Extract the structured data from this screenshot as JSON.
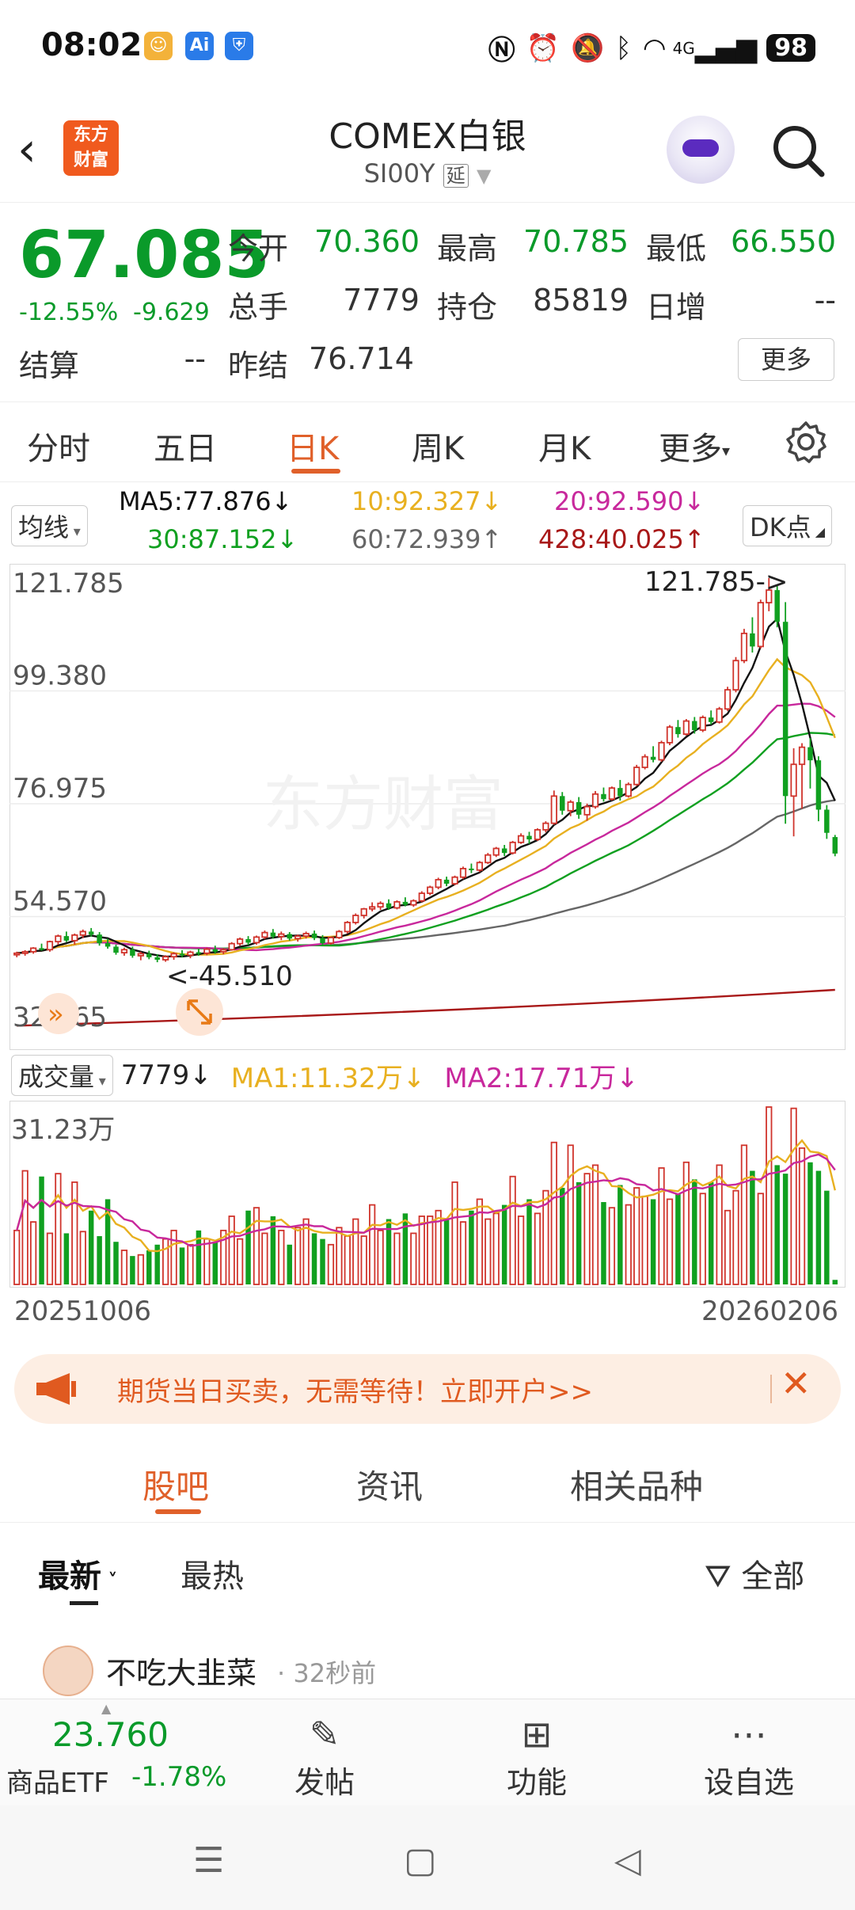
{
  "status": {
    "time": "08:02",
    "battery": "98",
    "net": "4G"
  },
  "header": {
    "back": "‹",
    "logo_line1": "东方",
    "logo_line2": "财富",
    "title": "COMEX白银",
    "code": "SI00Y",
    "delay_tag": "延"
  },
  "quote": {
    "price": "67.085",
    "pct": "-12.55%",
    "chg": "-9.629",
    "open_label": "今开",
    "open": "70.360",
    "high_label": "最高",
    "high": "70.785",
    "low_label": "最低",
    "low": "66.550",
    "vol_label": "总手",
    "vol": "7779",
    "oi_label": "持仓",
    "oi": "85819",
    "inc_label": "日增",
    "inc": "--",
    "settle_label": "结算",
    "settle": "--",
    "prev_label": "昨结",
    "prev": "76.714",
    "more": "更多"
  },
  "period_tabs": [
    "分时",
    "五日",
    "日K",
    "周K",
    "月K",
    "更多"
  ],
  "ma": {
    "selector": "均线",
    "dk": "DK点",
    "ma5": "MA5:77.876↓",
    "ma10": "10:92.327↓",
    "ma20": "20:92.590↓",
    "ma30": "30:87.152↓",
    "ma60": "60:72.939↑",
    "ma428": "428:40.025↑",
    "colors": {
      "ma5": "#111111",
      "ma10": "#e8b020",
      "ma20": "#c8289c",
      "ma30": "#10a020",
      "ma60": "#666666",
      "ma428": "#a81818"
    }
  },
  "chart_data": {
    "type": "candlestick",
    "y_ticks": [
      "121.785",
      "99.380",
      "76.975",
      "54.570",
      "32.165"
    ],
    "ylim": [
      32.165,
      121.785
    ],
    "high_marker": "121.785->",
    "low_marker": "<-45.510",
    "watermark": "东方财富",
    "start_date": "20251006",
    "end_date": "20260206",
    "candles": [
      [
        47.0,
        47.6,
        46.5,
        47.3
      ],
      [
        47.3,
        47.9,
        46.8,
        47.6
      ],
      [
        47.6,
        48.5,
        47.2,
        48.3
      ],
      [
        48.3,
        49.2,
        47.8,
        48.0
      ],
      [
        48.0,
        49.8,
        47.6,
        49.6
      ],
      [
        49.6,
        51.0,
        49.0,
        50.7
      ],
      [
        50.7,
        51.6,
        49.5,
        49.8
      ],
      [
        49.8,
        51.2,
        49.0,
        50.9
      ],
      [
        50.9,
        52.0,
        50.3,
        51.6
      ],
      [
        51.6,
        52.3,
        50.6,
        51.0
      ],
      [
        51.0,
        51.5,
        48.8,
        49.3
      ],
      [
        49.3,
        50.2,
        48.2,
        48.6
      ],
      [
        48.6,
        49.0,
        47.0,
        47.4
      ],
      [
        47.4,
        48.4,
        46.8,
        48.0
      ],
      [
        48.0,
        48.6,
        46.4,
        46.8
      ],
      [
        46.8,
        47.6,
        45.9,
        47.2
      ],
      [
        47.2,
        47.8,
        46.1,
        46.5
      ],
      [
        46.5,
        47.1,
        45.51,
        46.0
      ],
      [
        46.0,
        46.9,
        45.6,
        46.6
      ],
      [
        46.6,
        47.5,
        46.0,
        47.2
      ],
      [
        47.2,
        47.9,
        46.5,
        46.9
      ],
      [
        46.9,
        47.8,
        46.3,
        47.5
      ],
      [
        47.5,
        48.2,
        46.8,
        47.3
      ],
      [
        47.3,
        48.4,
        46.9,
        48.1
      ],
      [
        48.1,
        48.8,
        47.2,
        47.6
      ],
      [
        47.6,
        48.3,
        47.1,
        48.0
      ],
      [
        48.0,
        49.5,
        47.8,
        49.2
      ],
      [
        49.2,
        50.4,
        48.8,
        50.1
      ],
      [
        50.1,
        50.7,
        48.9,
        49.4
      ],
      [
        49.4,
        50.8,
        49.0,
        50.5
      ],
      [
        50.5,
        51.8,
        50.1,
        51.4
      ],
      [
        51.4,
        52.1,
        50.2,
        50.6
      ],
      [
        50.6,
        51.6,
        49.9,
        51.1
      ],
      [
        51.1,
        51.5,
        49.8,
        50.2
      ],
      [
        50.2,
        51.0,
        49.6,
        50.7
      ],
      [
        50.7,
        51.6,
        50.2,
        51.2
      ],
      [
        51.2,
        51.8,
        49.9,
        50.3
      ],
      [
        50.3,
        50.9,
        48.8,
        49.3
      ],
      [
        49.3,
        50.6,
        49.0,
        50.4
      ],
      [
        50.4,
        51.9,
        50.1,
        51.6
      ],
      [
        51.6,
        53.7,
        51.2,
        53.4
      ],
      [
        53.4,
        55.2,
        53.0,
        54.8
      ],
      [
        54.8,
        56.3,
        54.2,
        56.1
      ],
      [
        56.1,
        57.4,
        55.6,
        56.5
      ],
      [
        56.5,
        57.6,
        55.9,
        57.2
      ],
      [
        57.2,
        58.0,
        55.9,
        56.3
      ],
      [
        56.3,
        57.8,
        56.0,
        57.5
      ],
      [
        57.5,
        58.4,
        56.6,
        56.9
      ],
      [
        56.9,
        58.0,
        56.5,
        57.7
      ],
      [
        57.7,
        59.6,
        57.4,
        59.2
      ],
      [
        59.2,
        60.7,
        58.8,
        60.4
      ],
      [
        60.4,
        62.3,
        60.0,
        61.9
      ],
      [
        61.9,
        62.5,
        60.6,
        61.1
      ],
      [
        61.1,
        62.7,
        60.8,
        62.4
      ],
      [
        62.4,
        64.5,
        62.0,
        64.1
      ],
      [
        64.1,
        65.1,
        63.2,
        63.8
      ],
      [
        63.8,
        65.6,
        63.4,
        65.3
      ],
      [
        65.3,
        67.2,
        65.0,
        66.8
      ],
      [
        66.8,
        68.4,
        66.4,
        68.1
      ],
      [
        68.1,
        68.8,
        66.6,
        67.2
      ],
      [
        67.2,
        69.6,
        66.9,
        69.3
      ],
      [
        69.3,
        71.1,
        69.0,
        70.6
      ],
      [
        70.6,
        71.4,
        69.0,
        69.9
      ],
      [
        69.9,
        72.1,
        69.6,
        71.8
      ],
      [
        71.8,
        73.5,
        71.3,
        73.1
      ],
      [
        73.1,
        79.6,
        72.8,
        78.5
      ],
      [
        78.5,
        79.3,
        74.8,
        75.6
      ],
      [
        75.6,
        77.7,
        74.5,
        77.3
      ],
      [
        77.3,
        78.3,
        74.0,
        74.8
      ],
      [
        74.8,
        77.0,
        73.6,
        76.4
      ],
      [
        76.4,
        79.5,
        76.0,
        78.9
      ],
      [
        78.9,
        80.2,
        77.4,
        77.9
      ],
      [
        77.9,
        80.4,
        77.6,
        80.1
      ],
      [
        80.1,
        81.7,
        77.6,
        78.5
      ],
      [
        78.5,
        81.2,
        78.2,
        80.8
      ],
      [
        80.8,
        84.7,
        80.5,
        84.2
      ],
      [
        84.2,
        86.8,
        83.8,
        86.3
      ],
      [
        86.3,
        88.4,
        85.2,
        85.7
      ],
      [
        85.7,
        89.5,
        85.3,
        89.1
      ],
      [
        89.1,
        92.6,
        88.6,
        92.2
      ],
      [
        92.2,
        93.6,
        90.1,
        90.8
      ],
      [
        90.8,
        93.8,
        90.5,
        93.4
      ],
      [
        93.4,
        94.2,
        90.9,
        91.6
      ],
      [
        91.6,
        94.5,
        91.2,
        94.1
      ],
      [
        94.1,
        95.5,
        92.7,
        93.2
      ],
      [
        93.2,
        96.2,
        92.9,
        95.8
      ],
      [
        95.8,
        100.2,
        95.4,
        99.6
      ],
      [
        99.6,
        106.1,
        99.1,
        105.4
      ],
      [
        105.4,
        111.7,
        104.9,
        110.8
      ],
      [
        110.8,
        114.0,
        107.0,
        108.2
      ],
      [
        108.2,
        117.5,
        107.8,
        116.9
      ],
      [
        116.9,
        121.785,
        115.2,
        119.4
      ],
      [
        119.4,
        120.5,
        112.0,
        113.1
      ],
      [
        113.1,
        117.0,
        73.0,
        78.5
      ],
      [
        78.5,
        88.0,
        70.5,
        84.8
      ],
      [
        84.8,
        89.0,
        76.0,
        88.2
      ],
      [
        88.2,
        90.0,
        80.0,
        85.6
      ],
      [
        85.6,
        86.4,
        73.5,
        75.8
      ],
      [
        75.8,
        76.714,
        70.0,
        71.2
      ],
      [
        70.36,
        70.785,
        66.55,
        67.085
      ]
    ],
    "volume": {
      "ymax_label": "31.23万",
      "ymax": 31.23,
      "values": [
        9.5,
        20,
        11,
        19,
        9,
        19.5,
        9,
        18,
        9.3,
        13,
        8.5,
        15,
        7.5,
        6,
        5,
        5.2,
        6,
        7,
        8,
        9.5,
        6.5,
        7,
        9.5,
        8,
        7.5,
        9.5,
        12,
        8,
        13,
        13.5,
        9,
        12,
        9.5,
        7,
        10,
        11.5,
        9,
        8,
        7,
        10,
        8.5,
        11.5,
        8.5,
        14,
        9.5,
        11.5,
        9,
        12.5,
        9,
        12,
        12,
        13,
        11.5,
        18,
        11,
        13,
        15,
        11.5,
        12.5,
        14,
        19,
        12,
        15,
        12.5,
        16.5,
        25,
        17,
        24.5,
        18,
        19.5,
        21,
        14.5,
        13.5,
        17.5,
        14,
        17,
        15.5,
        15,
        20.5,
        15,
        16,
        21.5,
        18.5,
        16,
        18,
        21,
        13,
        16.5,
        24.5,
        20,
        16,
        31.23,
        21,
        19.5,
        31,
        24,
        21.5,
        20,
        16.5,
        0.8
      ]
    }
  },
  "vol_legend": {
    "selector": "成交量",
    "vol": "7779↓",
    "ma1": "MA1:11.32万↓",
    "ma2": "MA2:17.71万↓"
  },
  "ad": {
    "text": "期货当日买卖，无需等待！立即开户>>",
    "close": "✕"
  },
  "section_tabs": [
    "股吧",
    "资讯",
    "相关品种"
  ],
  "filters": {
    "latest": "最新",
    "hot": "最热",
    "all": "全部"
  },
  "post": {
    "user": "不吃大韭菜",
    "time": "· 32秒前"
  },
  "bottom": {
    "etf_price": "23.760",
    "etf_name": "商品ETF",
    "etf_pct": "-1.78%",
    "post_label": "发帖",
    "func_label": "功能",
    "watch_label": "设自选"
  }
}
